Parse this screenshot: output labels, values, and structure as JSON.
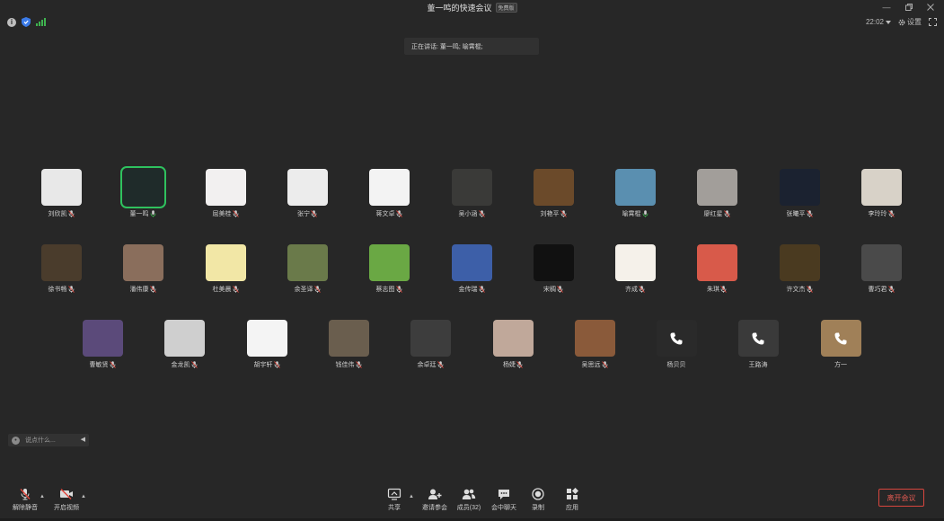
{
  "window": {
    "title": "董一鸣的快速会议",
    "badge": "免费版"
  },
  "top_right": {
    "time": "22:02",
    "settings_label": "设置"
  },
  "speaking": {
    "text": "正在讲话: 董一鸣; 喻霄棍;"
  },
  "participants": [
    {
      "name": "刘欣凯",
      "mic": "muted",
      "color": "#e8e8e8",
      "active": false
    },
    {
      "name": "董一鸣",
      "mic": "on",
      "color": "#1f2b2a",
      "active": true
    },
    {
      "name": "屈美桂",
      "mic": "muted",
      "color": "#f2f0f0",
      "active": false
    },
    {
      "name": "张宁",
      "mic": "muted",
      "color": "#ececec",
      "active": false
    },
    {
      "name": "蒋文卓",
      "mic": "muted",
      "color": "#f3f3f3",
      "active": false
    },
    {
      "name": "吴小涵",
      "mic": "muted",
      "color": "#3a3a38",
      "active": false
    },
    {
      "name": "刘艳平",
      "mic": "muted",
      "color": "#6b4a2a",
      "active": false
    },
    {
      "name": "喻霄棍",
      "mic": "on",
      "color": "#5a8fb0",
      "active": false
    },
    {
      "name": "廖红星",
      "mic": "muted",
      "color": "#a29e9a",
      "active": false
    },
    {
      "name": "张曦平",
      "mic": "muted",
      "color": "#1b2230",
      "active": false
    },
    {
      "name": "李玲玲",
      "mic": "muted",
      "color": "#d8d2c8",
      "active": false
    },
    {
      "name": "徐书畅",
      "mic": "muted",
      "color": "#4a3c2c",
      "active": false
    },
    {
      "name": "潘伟康",
      "mic": "muted",
      "color": "#8a6e5c",
      "active": false
    },
    {
      "name": "杜美晨",
      "mic": "muted",
      "color": "#f2e7a6",
      "active": false
    },
    {
      "name": "余圣译",
      "mic": "muted",
      "color": "#6a7a4a",
      "active": false
    },
    {
      "name": "蔡志图",
      "mic": "muted",
      "color": "#6aa844",
      "active": false
    },
    {
      "name": "金传瑞",
      "mic": "muted",
      "color": "#3d5fa8",
      "active": false
    },
    {
      "name": "宋稠",
      "mic": "muted",
      "color": "#111111",
      "active": false
    },
    {
      "name": "齐成",
      "mic": "muted",
      "color": "#f5f1ea",
      "active": false
    },
    {
      "name": "朱琪",
      "mic": "muted",
      "color": "#d85a4a",
      "active": false
    },
    {
      "name": "许文杰",
      "mic": "muted",
      "color": "#4a3a20",
      "active": false
    },
    {
      "name": "曹巧君",
      "mic": "muted",
      "color": "#4a4a4a",
      "active": false
    },
    {
      "name": "曹敏贤",
      "mic": "muted",
      "color": "#5b4a7a",
      "active": false
    },
    {
      "name": "金龙凯",
      "mic": "muted",
      "color": "#cfcfcf",
      "active": false
    },
    {
      "name": "胡宇轩",
      "mic": "muted",
      "color": "#f4f4f4",
      "active": false
    },
    {
      "name": "钱佳伟",
      "mic": "muted",
      "color": "#6a5e4e",
      "active": false
    },
    {
      "name": "余卓廷",
      "mic": "muted",
      "color": "#3d3d3d",
      "active": false
    },
    {
      "name": "杨婕",
      "mic": "muted",
      "color": "#c0a89a",
      "active": false
    },
    {
      "name": "吴思远",
      "mic": "muted",
      "color": "#8a5a3a",
      "active": false
    },
    {
      "name": "杨贝贝",
      "mic": "none",
      "color": "#2a2a2a",
      "active": false,
      "phone": true
    },
    {
      "name": "王路涛",
      "mic": "none",
      "color": "#3a3a3a",
      "active": false,
      "phone": true
    },
    {
      "name": "方一",
      "mic": "none",
      "color": "#a08058",
      "active": false,
      "phone": true
    }
  ],
  "chat": {
    "placeholder": "说点什么..."
  },
  "toolbar": {
    "unmute": "解除静音",
    "start_video": "开启视频",
    "share": "共享",
    "invite": "邀请参会",
    "members": "成员(32)",
    "chat": "会中聊天",
    "record": "录制",
    "apps": "应用",
    "leave": "离开会议"
  },
  "colors": {
    "background": "#272727",
    "active_speaker": "#2ec25f",
    "leave": "#e05a52",
    "signal": "#3fb34f",
    "shield": "#3b7be8"
  }
}
